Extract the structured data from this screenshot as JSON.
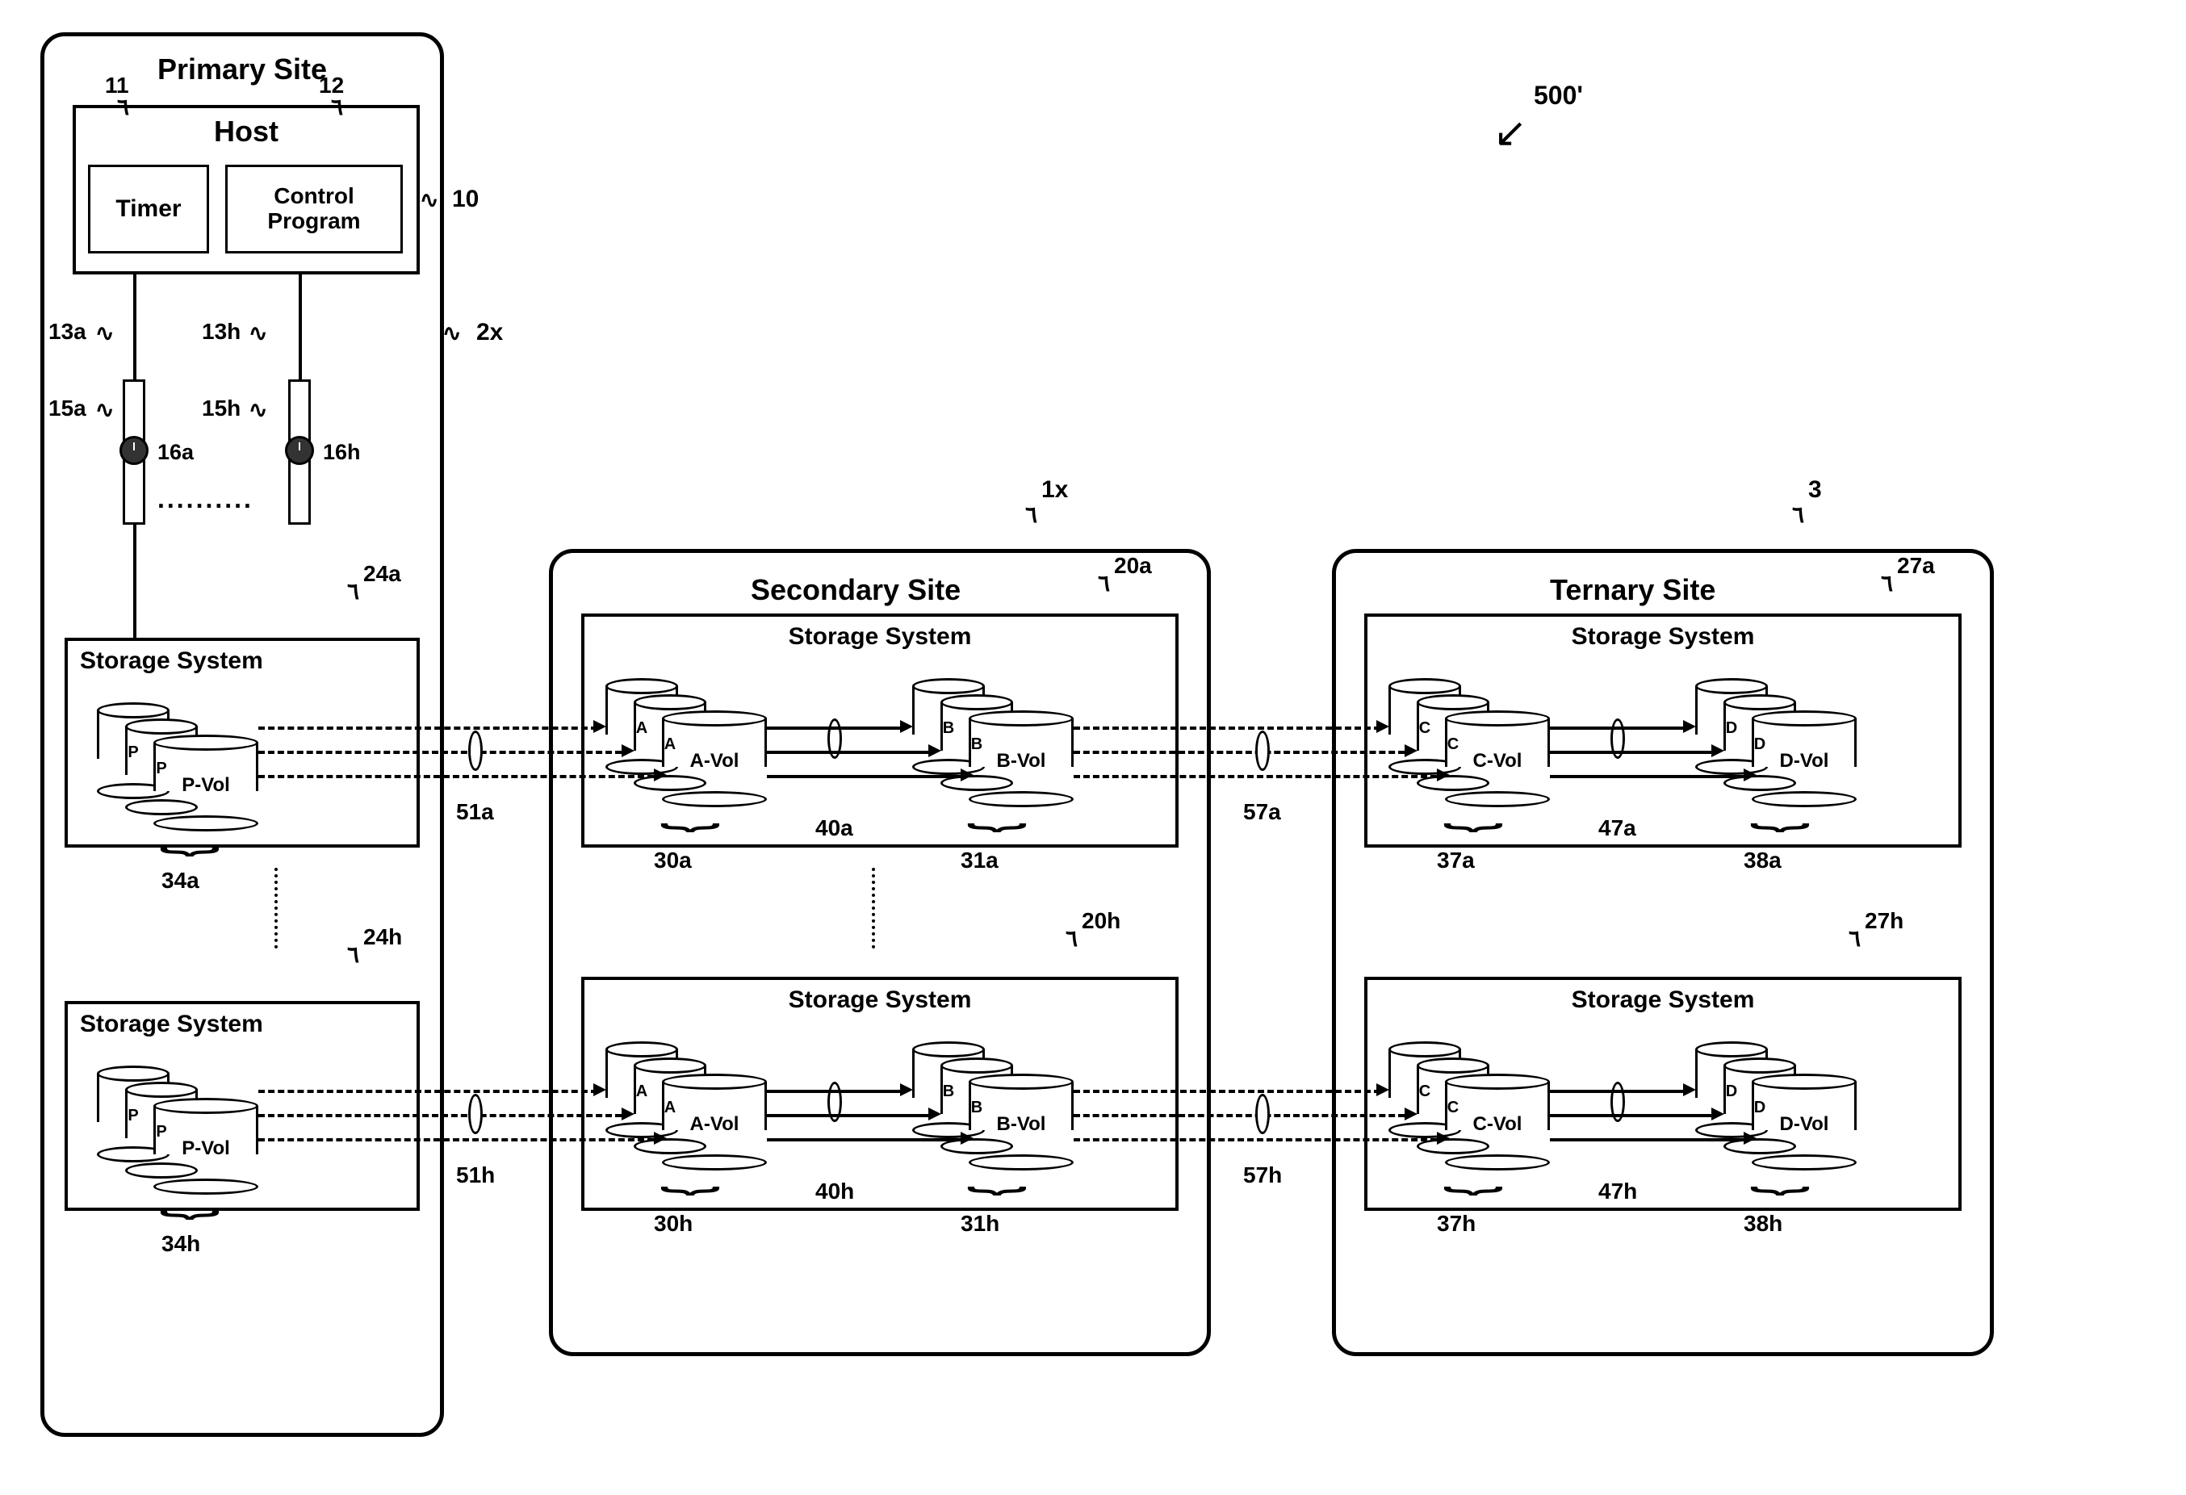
{
  "figure_ref": "500'",
  "sites": {
    "primary": {
      "title": "Primary Site",
      "ref": "2x",
      "host": {
        "title": "Host",
        "ref": "10",
        "timer": {
          "label": "Timer",
          "ref": "11"
        },
        "ctrl": {
          "label": "Control\nProgram",
          "ref": "12"
        }
      },
      "conn_a": {
        "ref": "13a"
      },
      "conn_h": {
        "ref": "13h"
      },
      "rect_a": {
        "ref": "15a"
      },
      "rect_h": {
        "ref": "15h"
      },
      "clock_a": {
        "ref": "16a"
      },
      "clock_h": {
        "ref": "16h"
      },
      "storage": [
        {
          "title": "Storage System",
          "ref": "24a",
          "vol_label": "P-Vol",
          "vol_short": "P",
          "group_ref": "34a"
        },
        {
          "title": "Storage System",
          "ref": "24h",
          "vol_label": "P-Vol",
          "vol_short": "P",
          "group_ref": "34h"
        }
      ]
    },
    "secondary": {
      "title": "Secondary Site",
      "ref": "1x",
      "storage": [
        {
          "title": "Storage System",
          "ref": "20a",
          "a_label": "A-Vol",
          "a_short": "A",
          "a_group": "30a",
          "b_label": "B-Vol",
          "b_short": "B",
          "b_group": "31a",
          "mid_ref": "40a"
        },
        {
          "title": "Storage System",
          "ref": "20h",
          "a_label": "A-Vol",
          "a_short": "A",
          "a_group": "30h",
          "b_label": "B-Vol",
          "b_short": "B",
          "b_group": "31h",
          "mid_ref": "40h"
        }
      ]
    },
    "ternary": {
      "title": "Ternary Site",
      "ref": "3",
      "storage": [
        {
          "title": "Storage System",
          "ref": "27a",
          "c_label": "C-Vol",
          "c_short": "C",
          "c_group": "37a",
          "d_label": "D-Vol",
          "d_short": "D",
          "d_group": "38a",
          "mid_ref": "47a"
        },
        {
          "title": "Storage System",
          "ref": "27h",
          "c_label": "C-Vol",
          "c_short": "C",
          "c_group": "37h",
          "d_label": "D-Vol",
          "d_short": "D",
          "d_group": "38h",
          "mid_ref": "47h"
        }
      ]
    }
  },
  "links": {
    "ps_a": "51a",
    "ps_h": "51h",
    "st_a": "57a",
    "st_h": "57h"
  }
}
